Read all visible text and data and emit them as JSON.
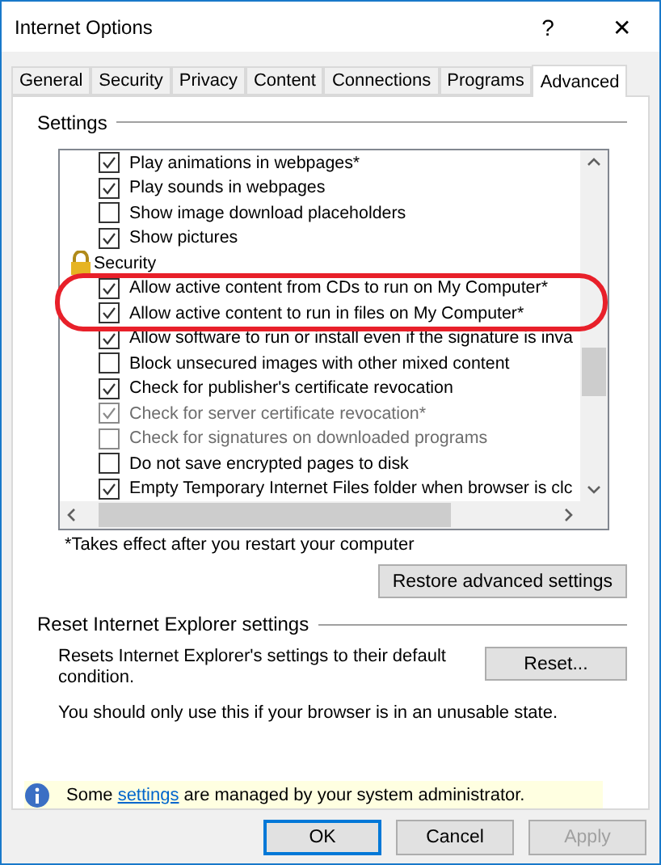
{
  "window": {
    "title": "Internet Options",
    "help": "?",
    "close": "✕"
  },
  "tabs": [
    {
      "label": "General",
      "selected": false
    },
    {
      "label": "Security",
      "selected": false
    },
    {
      "label": "Privacy",
      "selected": false
    },
    {
      "label": "Content",
      "selected": false
    },
    {
      "label": "Connections",
      "selected": false
    },
    {
      "label": "Programs",
      "selected": false
    },
    {
      "label": "Advanced",
      "selected": true
    }
  ],
  "settings": {
    "title": "Settings",
    "items": [
      {
        "kind": "option",
        "label": "Play animations in webpages*",
        "checked": true,
        "disabled": false
      },
      {
        "kind": "option",
        "label": "Play sounds in webpages",
        "checked": true,
        "disabled": false
      },
      {
        "kind": "option",
        "label": "Show image download placeholders",
        "checked": false,
        "disabled": false
      },
      {
        "kind": "option",
        "label": "Show pictures",
        "checked": true,
        "disabled": false
      },
      {
        "kind": "category",
        "label": "Security"
      },
      {
        "kind": "option",
        "label": "Allow active content from CDs to run on My Computer*",
        "checked": true,
        "disabled": false
      },
      {
        "kind": "option",
        "label": "Allow active content to run in files on My Computer*",
        "checked": true,
        "disabled": false
      },
      {
        "kind": "option",
        "label": "Allow software to run or install even if the signature is inva",
        "checked": true,
        "disabled": false
      },
      {
        "kind": "option",
        "label": "Block unsecured images with other mixed content",
        "checked": false,
        "disabled": false
      },
      {
        "kind": "option",
        "label": "Check for publisher's certificate revocation",
        "checked": true,
        "disabled": false
      },
      {
        "kind": "option",
        "label": "Check for server certificate revocation*",
        "checked": true,
        "disabled": true
      },
      {
        "kind": "option",
        "label": "Check for signatures on downloaded programs",
        "checked": false,
        "disabled": true
      },
      {
        "kind": "option",
        "label": "Do not save encrypted pages to disk",
        "checked": false,
        "disabled": false
      },
      {
        "kind": "option",
        "label": "Empty Temporary Internet Files folder when browser is clc",
        "checked": true,
        "disabled": false
      }
    ],
    "footnote": "*Takes effect after you restart your computer",
    "restore_button": "Restore advanced settings"
  },
  "reset": {
    "title": "Reset Internet Explorer settings",
    "description": "Resets Internet Explorer's settings to their default condition.",
    "button": "Reset...",
    "note": "You should only use this if your browser is in an unusable state."
  },
  "info_bar": {
    "before": "Some",
    "link": "settings",
    "after": "are managed by your system administrator."
  },
  "buttons": [
    {
      "label": "OK",
      "disabled": false,
      "default": true
    },
    {
      "label": "Cancel",
      "disabled": false,
      "default": false
    },
    {
      "label": "Apply",
      "disabled": true,
      "default": false
    }
  ]
}
